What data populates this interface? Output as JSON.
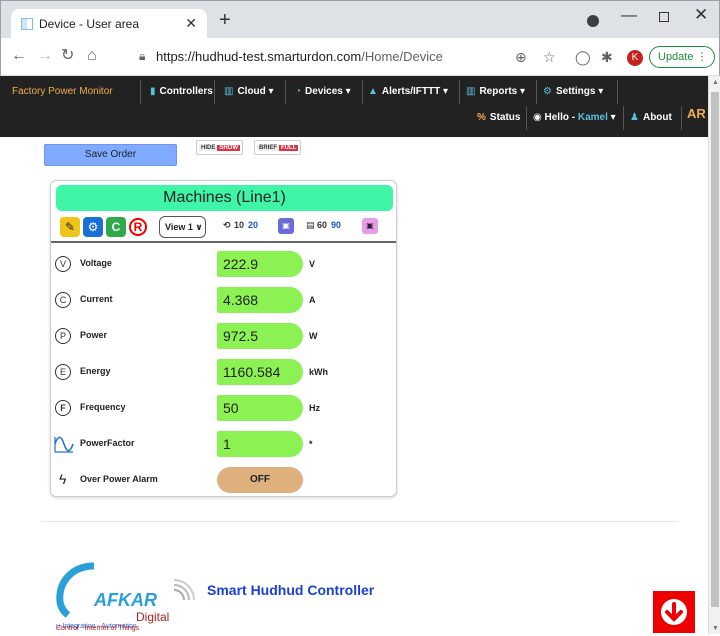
{
  "browser": {
    "tab_title": "Device - User area",
    "url_host": "https://hudhud-test.smarturdon.com",
    "url_path": "/Home/Device",
    "avatar_letter": "K",
    "update_label": "Update"
  },
  "navbar": {
    "brand": "Factory Power Monitor",
    "items": [
      "Controllers",
      "Cloud",
      "Devices",
      "Alerts/IFTTT",
      "Reports",
      "Settings"
    ],
    "status": "Status",
    "hello": "Hello -",
    "user": "Kamel",
    "about": "About",
    "lang": "AR"
  },
  "toolbar": {
    "save_order": "Save Order",
    "hide": "HIDE",
    "show": "SHOW",
    "brief": "BRIEF",
    "full": "FULL"
  },
  "card": {
    "title": "Machines (Line1)",
    "view_select": "View 1",
    "interval1_a": "10",
    "interval1_b": "20",
    "interval2_a": "60",
    "interval2_b": "90",
    "rows": [
      {
        "icon": "V",
        "label": "Voltage",
        "value": "222.9",
        "unit": "V"
      },
      {
        "icon": "C",
        "label": "Current",
        "value": "4.368",
        "unit": "A"
      },
      {
        "icon": "P",
        "label": "Power",
        "value": "972.5",
        "unit": "W"
      },
      {
        "icon": "E",
        "label": "Energy",
        "value": "1160.584",
        "unit": "kWh"
      },
      {
        "icon": "F",
        "label": "Frequency",
        "value": "50",
        "unit": "Hz"
      },
      {
        "icon": "",
        "label": "PowerFactor",
        "value": "1",
        "unit": "*"
      }
    ],
    "alarm": {
      "label": "Over Power Alarm",
      "state": "OFF"
    }
  },
  "footer": {
    "logo_name": "AFKAR",
    "logo_sub": "Digital",
    "logo_tag1": "μ-Integration  -  Automation",
    "logo_tag2": "Control  -  Internet of Things",
    "title": "Smart Hudhud Controller"
  },
  "colors": {
    "title_bar": "#3ef5a8",
    "value_bg": "#8cf253",
    "alarm_bg": "#ddb07e",
    "brand": "#f0ad4e"
  }
}
